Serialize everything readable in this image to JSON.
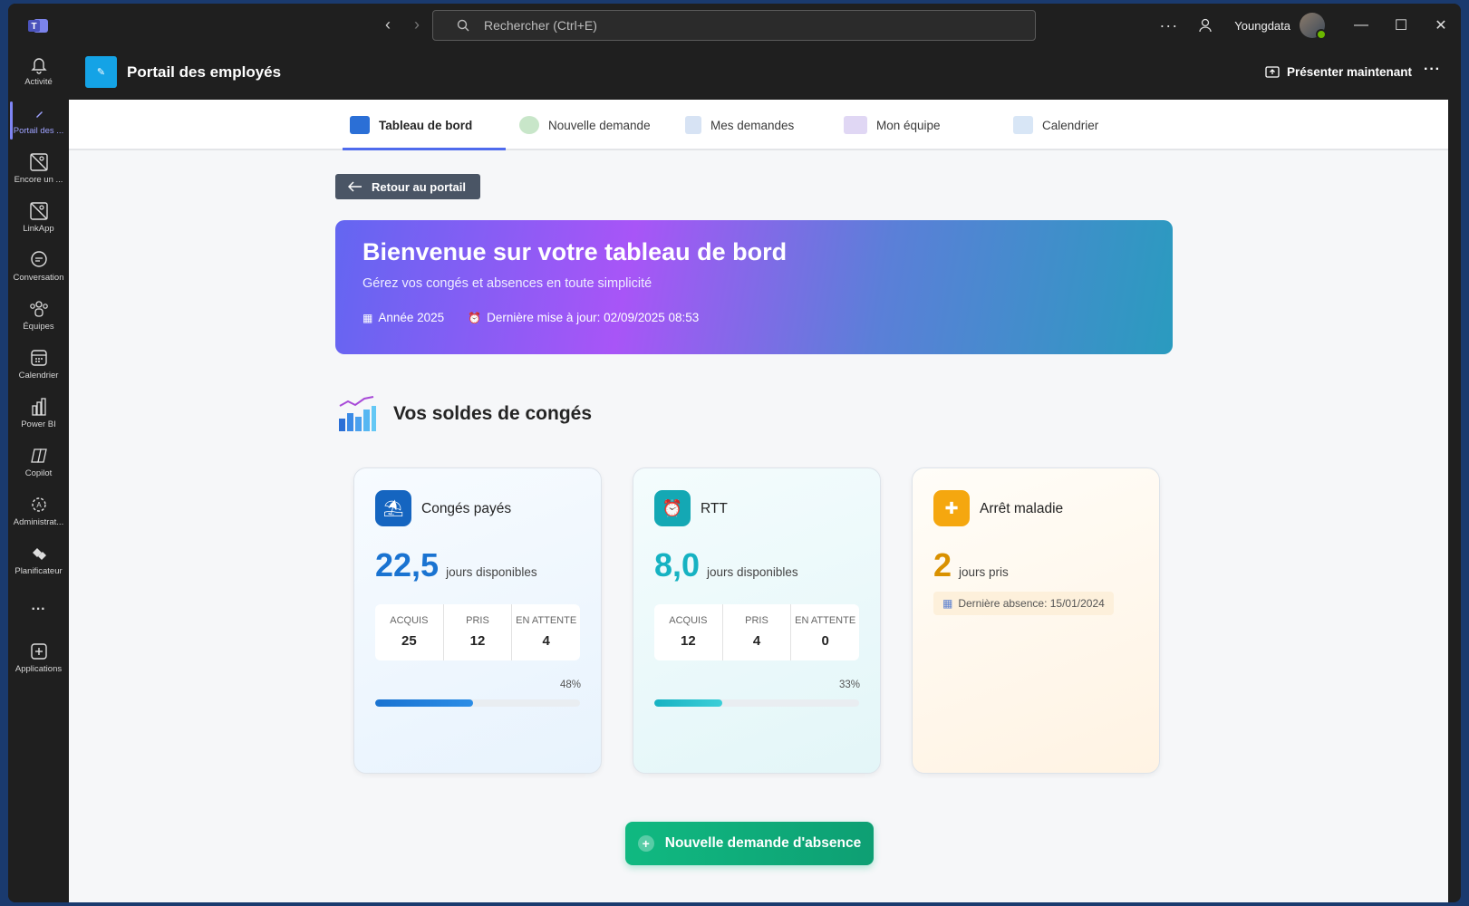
{
  "titlebar": {
    "search_placeholder": "Rechercher (Ctrl+E)",
    "user_name": "Youngdata",
    "more": "···"
  },
  "rail": {
    "items": [
      {
        "label": "Activité",
        "icon": "bell-icon"
      },
      {
        "label": "Portail des ...",
        "icon": "pencil-icon"
      },
      {
        "label": "Encore un ...",
        "icon": "app-placeholder-icon"
      },
      {
        "label": "LinkApp",
        "icon": "app-placeholder-icon"
      },
      {
        "label": "Conversation",
        "icon": "chat-icon"
      },
      {
        "label": "Équipes",
        "icon": "teams-icon"
      },
      {
        "label": "Calendrier",
        "icon": "calendar-icon"
      },
      {
        "label": "Power BI",
        "icon": "powerbi-icon"
      },
      {
        "label": "Copilot",
        "icon": "copilot-icon"
      },
      {
        "label": "Administrat...",
        "icon": "admin-icon"
      },
      {
        "label": "Planificateur",
        "icon": "planner-icon"
      },
      {
        "label": "···",
        "icon": "more-icon"
      },
      {
        "label": "Applications",
        "icon": "add-apps-icon"
      }
    ]
  },
  "appbar": {
    "title": "Portail des employés",
    "present": "Présenter maintenant",
    "more": "···"
  },
  "tabs": [
    {
      "label": "Tableau de bord",
      "color": "#2b6fd6"
    },
    {
      "label": "Nouvelle demande",
      "color": "#c8e6c9"
    },
    {
      "label": "Mes demandes",
      "color": "#d7e3f4"
    },
    {
      "label": "Mon équipe",
      "color": "#e0d7f4"
    },
    {
      "label": "Calendrier",
      "color": "#d8e6f6"
    }
  ],
  "back_button": "Retour au portail",
  "hero": {
    "title": "Bienvenue sur votre tableau de bord",
    "subtitle": "Gérez vos congés et absences en toute simplicité",
    "year": "Année 2025",
    "last_update": "Dernière mise à jour: 02/09/2025 08:53"
  },
  "section_title": "Vos soldes de congés",
  "cards": [
    {
      "title": "Congés payés",
      "value": "22,5",
      "unit": "jours disponibles",
      "accent": "#1a73d1",
      "icon_bg": "#1565c0",
      "stats": [
        {
          "label": "Acquis",
          "value": "25"
        },
        {
          "label": "Pris",
          "value": "12"
        },
        {
          "label": "En attente",
          "value": "4"
        }
      ],
      "percent_label": "48%",
      "percent": 48
    },
    {
      "title": "RTT",
      "value": "8,0",
      "unit": "jours disponibles",
      "accent": "#16b2c2",
      "icon_bg": "#14a8b4",
      "stats": [
        {
          "label": "Acquis",
          "value": "12"
        },
        {
          "label": "Pris",
          "value": "4"
        },
        {
          "label": "En attente",
          "value": "0"
        }
      ],
      "percent_label": "33%",
      "percent": 33
    },
    {
      "title": "Arrêt maladie",
      "value": "2",
      "unit": "jours pris",
      "accent": "#d99100",
      "icon_bg": "#f5a70f",
      "last_absence": "Dernière absence: 15/01/2024"
    }
  ],
  "cta": "Nouvelle demande d'absence"
}
